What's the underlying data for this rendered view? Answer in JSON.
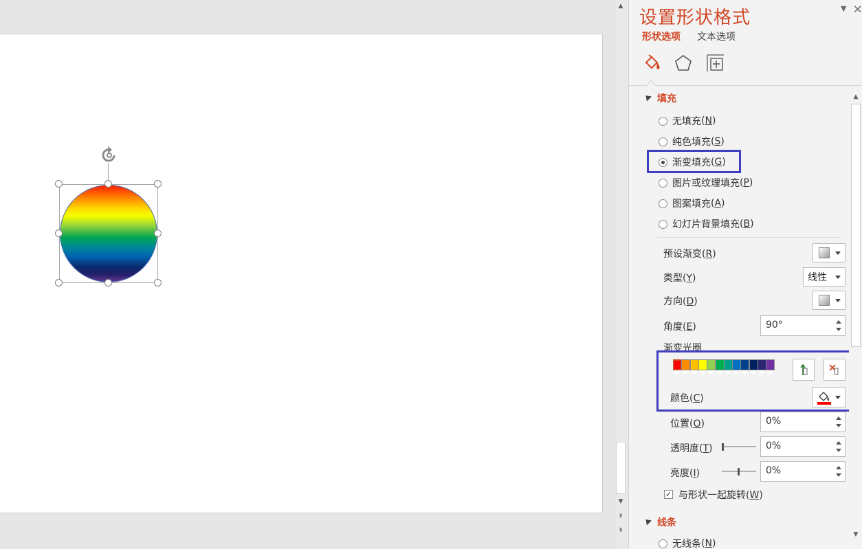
{
  "pane": {
    "title": "设置形状格式",
    "tabs": [
      {
        "label": "形状选项"
      },
      {
        "label": "文本选项"
      }
    ],
    "sections": {
      "fill": {
        "title": "填充",
        "options": [
          {
            "label": "无填充",
            "key": "N"
          },
          {
            "label": "纯色填充",
            "key": "S"
          },
          {
            "label": "渐变填充",
            "key": "G"
          },
          {
            "label": "图片或纹理填充",
            "key": "P"
          },
          {
            "label": "图案填充",
            "key": "A"
          },
          {
            "label": "幻灯片背景填充",
            "key": "B"
          }
        ],
        "selected_option": "渐变填充",
        "preset_gradient_label": "预设渐变",
        "preset_gradient_key": "R",
        "type_label": "类型",
        "type_key": "Y",
        "type_value": "线性",
        "direction_label": "方向",
        "direction_key": "D",
        "angle_label": "角度",
        "angle_key": "E",
        "angle_value": "90°",
        "gradient_stops_label": "渐变光圈",
        "gradient_stops": [
          {
            "color": "#ff0000"
          },
          {
            "color": "#ff8c00"
          },
          {
            "color": "#ffc000"
          },
          {
            "color": "#ffff00"
          },
          {
            "color": "#92d050"
          },
          {
            "color": "#00b050"
          },
          {
            "color": "#00a08a"
          },
          {
            "color": "#0070c0"
          },
          {
            "color": "#003f8c"
          },
          {
            "color": "#002060"
          },
          {
            "color": "#2c2570"
          },
          {
            "color": "#7030a0"
          }
        ],
        "color_label": "颜色",
        "color_key": "C",
        "color_value": "#ff0000",
        "position_label": "位置",
        "position_key": "O",
        "position_value": "0%",
        "transparency_label": "透明度",
        "transparency_key": "T",
        "transparency_value": "0%",
        "brightness_label": "亮度",
        "brightness_key": "I",
        "brightness_value": "0%",
        "rotate_with_shape_label": "与形状一起旋转",
        "rotate_with_shape_key": "W",
        "rotate_with_shape_checked": true
      },
      "line": {
        "title": "线条",
        "first_option_label": "无线条",
        "first_option_key": "N"
      }
    }
  },
  "colors": {
    "accent": "#d24726",
    "highlight": "#3f3fbf"
  }
}
